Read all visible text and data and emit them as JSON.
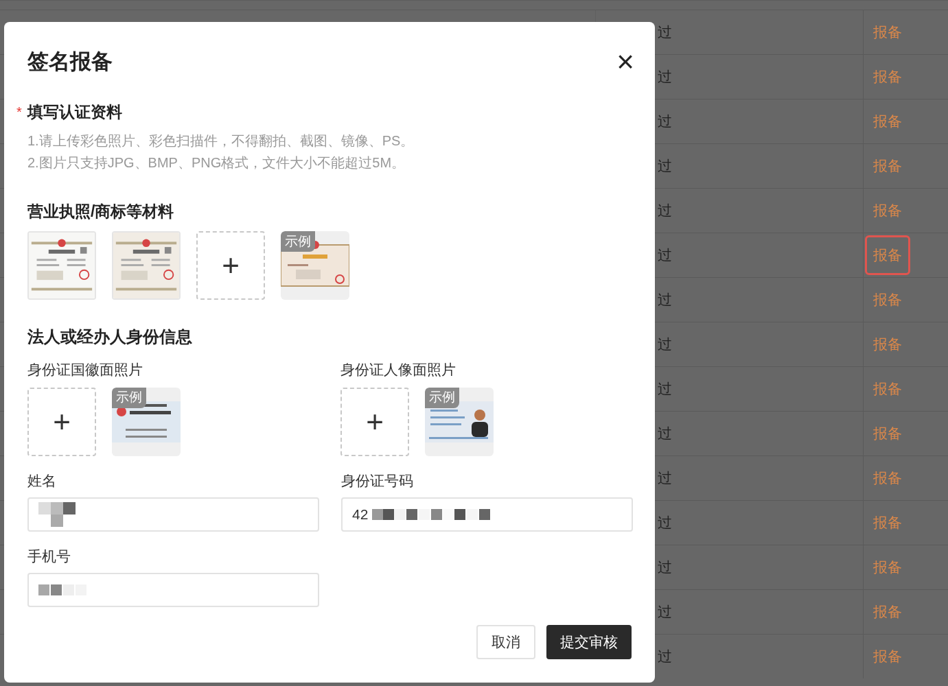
{
  "background_table": {
    "rows": [
      {
        "status": "过",
        "action": "报备",
        "highlighted": false
      },
      {
        "status": "过",
        "action": "报备",
        "highlighted": false
      },
      {
        "status": "过",
        "action": "报备",
        "highlighted": false
      },
      {
        "status": "过",
        "action": "报备",
        "highlighted": false
      },
      {
        "status": "过",
        "action": "报备",
        "highlighted": false
      },
      {
        "status": "过",
        "action": "报备",
        "highlighted": true
      },
      {
        "status": "过",
        "action": "报备",
        "highlighted": false
      },
      {
        "status": "过",
        "action": "报备",
        "highlighted": false
      },
      {
        "status": "过",
        "action": "报备",
        "highlighted": false
      },
      {
        "status": "过",
        "action": "报备",
        "highlighted": false
      },
      {
        "status": "过",
        "action": "报备",
        "highlighted": false
      },
      {
        "status": "过",
        "action": "报备",
        "highlighted": false
      },
      {
        "status": "过",
        "action": "报备",
        "highlighted": false
      },
      {
        "status": "过",
        "action": "报备",
        "highlighted": false
      },
      {
        "status": "过",
        "action": "报备",
        "highlighted": false
      }
    ]
  },
  "dialog": {
    "title": "签名报备",
    "close": "×",
    "section": {
      "required_mark": "*",
      "title": "填写认证资料",
      "hints": [
        "1.请上传彩色照片、彩色扫描件，不得翻拍、截图、镜像、PS。",
        "2.图片只支持JPG、BMP、PNG格式，文件大小不能超过5M。"
      ]
    },
    "materials": {
      "title": "营业执照/商标等材料",
      "tiles": [
        {
          "kind": "picture"
        },
        {
          "kind": "picture"
        },
        {
          "kind": "upload",
          "icon": "+"
        },
        {
          "kind": "example",
          "badge": "示例"
        }
      ]
    },
    "identity": {
      "title": "法人或经办人身份信息",
      "columns": [
        {
          "label": "身份证国徽面照片",
          "tiles": [
            {
              "kind": "upload",
              "icon": "+"
            },
            {
              "kind": "example",
              "badge": "示例"
            }
          ]
        },
        {
          "label": "身份证人像面照片",
          "tiles": [
            {
              "kind": "upload",
              "icon": "+"
            },
            {
              "kind": "example",
              "badge": "示例"
            }
          ]
        }
      ]
    },
    "fields": [
      {
        "label": "姓名",
        "redacted": true
      },
      {
        "label": "身份证号码",
        "value": "42",
        "redacted": true
      },
      {
        "label": "手机号",
        "redacted": true
      }
    ],
    "buttons": [
      {
        "label": "取消",
        "primary": false
      },
      {
        "label": "提交审核",
        "primary": true
      }
    ]
  }
}
